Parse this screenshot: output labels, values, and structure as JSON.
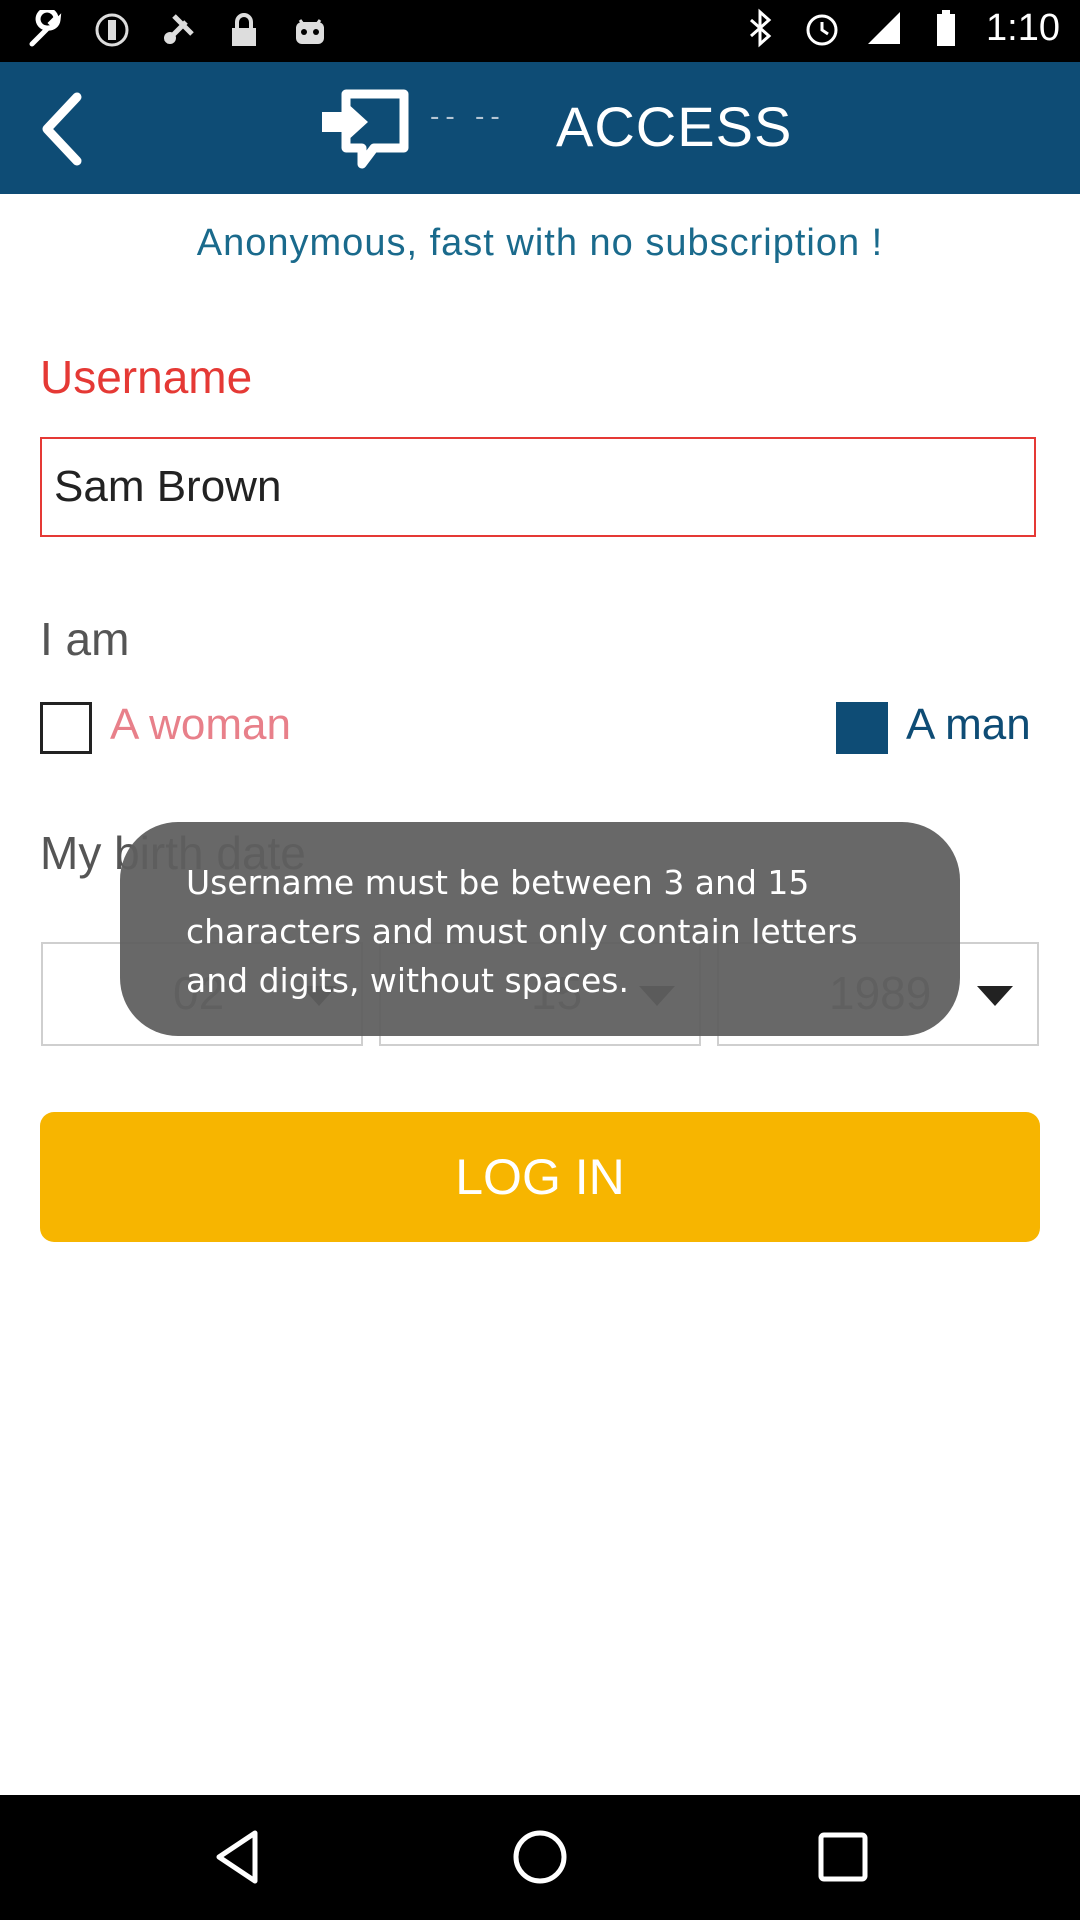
{
  "status_bar": {
    "time": "1:10",
    "icons": [
      "wrench-icon",
      "sync-icon",
      "fake-gps-icon",
      "lock-icon",
      "android-icon",
      "bluetooth-icon",
      "alarm-icon",
      "signal-icon",
      "battery-icon"
    ]
  },
  "app_bar": {
    "title": "ACCESS",
    "logo_dashes": "-- --",
    "back_icon": "chevron-left-icon"
  },
  "tagline": "Anonymous, fast with no subscription !",
  "form": {
    "username_label": "Username",
    "username_value": "Sam Brown",
    "gender_label": "I am",
    "gender_options": [
      {
        "label": "A woman",
        "checked": false
      },
      {
        "label": "A man",
        "checked": true
      }
    ],
    "birth_label": "My birth date",
    "birth_day": "02",
    "birth_month": "15",
    "birth_year": "1989",
    "login_label": "LOG IN"
  },
  "toast": {
    "line1": "Username must be between 3 and 15",
    "line2": "characters and must only contain letters",
    "line3": "and digits, without spaces."
  },
  "colors": {
    "app_bar": "#0e4c75",
    "accent_red": "#e53935",
    "button_yellow": "#f7b500",
    "tagline": "#1a6a8c"
  }
}
